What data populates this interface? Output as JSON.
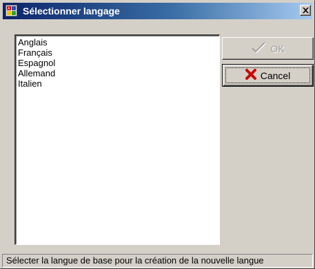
{
  "window": {
    "title": "Sélectionner langage",
    "app_icon": "language-app-icon",
    "close_icon": "close-icon"
  },
  "languages": {
    "items": [
      "Anglais",
      "Français",
      "Espagnol",
      "Allemand",
      "Italien"
    ]
  },
  "buttons": {
    "ok_label": "OK",
    "ok_icon": "checkmark-icon",
    "ok_enabled": false,
    "cancel_label": "Cancel",
    "cancel_icon": "red-x-icon"
  },
  "status": {
    "text": "Sélecter la langue de base pour la création de la nouvelle langue"
  },
  "colors": {
    "title_gradient_start": "#0a246a",
    "title_gradient_end": "#a6caf0",
    "face": "#d4d0c8",
    "cancel_icon": "#cc0000"
  }
}
